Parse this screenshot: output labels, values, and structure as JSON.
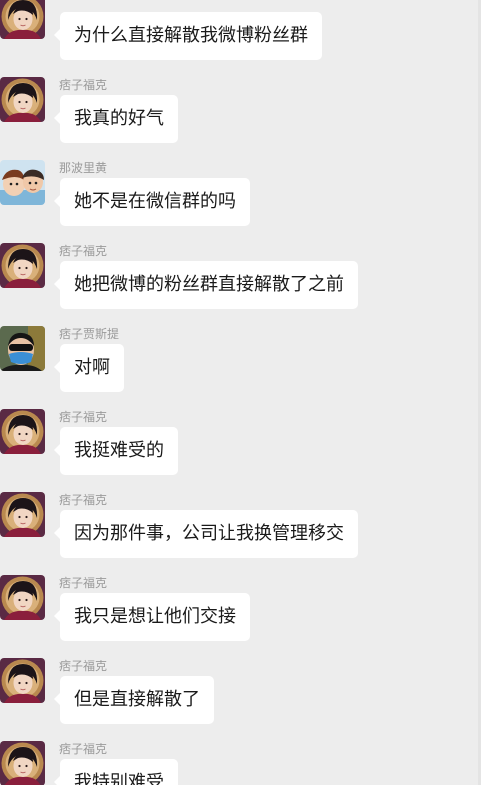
{
  "messages": [
    {
      "sender": "",
      "text": "为什么直接解散我微博粉丝群",
      "avatar": "portrait-icon"
    },
    {
      "sender": "痞子福克",
      "text": "我真的好气",
      "avatar": "portrait-icon"
    },
    {
      "sender": "那波里黄",
      "text": "她不是在微信群的吗",
      "avatar": "cartoon-icon"
    },
    {
      "sender": "痞子福克",
      "text": "她把微博的粉丝群直接解散了之前",
      "avatar": "portrait-icon"
    },
    {
      "sender": "痞子贾斯提",
      "text": "对啊",
      "avatar": "masked-face-icon"
    },
    {
      "sender": "痞子福克",
      "text": "我挺难受的",
      "avatar": "portrait-icon"
    },
    {
      "sender": "痞子福克",
      "text": "因为那件事，公司让我换管理移交",
      "avatar": "portrait-icon"
    },
    {
      "sender": "痞子福克",
      "text": "我只是想让他们交接",
      "avatar": "portrait-icon"
    },
    {
      "sender": "痞子福克",
      "text": "但是直接解散了",
      "avatar": "portrait-icon"
    },
    {
      "sender": "痞子福克",
      "text": "我特别难受",
      "avatar": "portrait-icon"
    }
  ],
  "colors": {
    "background": "#ededed",
    "bubble": "#ffffff",
    "sender_name": "#9a9a9a",
    "message_text": "#1a1a1a"
  }
}
